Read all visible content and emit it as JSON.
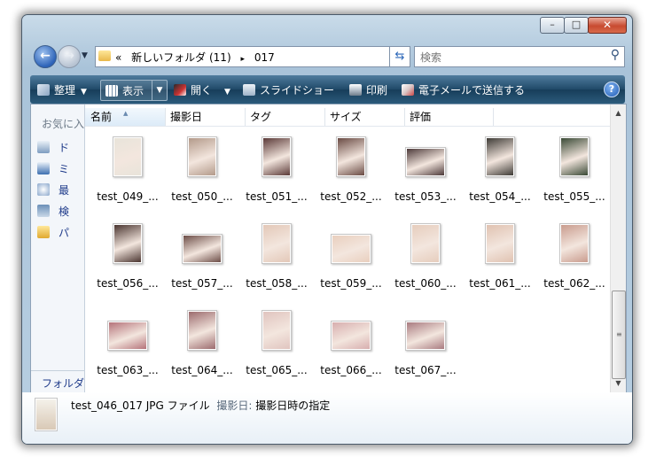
{
  "window": {
    "caption": {
      "minimize": "–",
      "maximize": "□",
      "close": "✕"
    }
  },
  "address": {
    "crumbs": [
      "«",
      "新しいフォルダ (11)",
      "▸",
      "017"
    ],
    "search_placeholder": "検索"
  },
  "toolbar": {
    "organize": "整理",
    "view": "表示",
    "open": "開く",
    "slideshow": "スライドショー",
    "print": "印刷",
    "email": "電子メールで送信する",
    "help": "?"
  },
  "nav": {
    "favorites_title": "お気に入",
    "items": [
      "ド",
      "ミ",
      "最",
      "検",
      "パ"
    ],
    "folders_label": "フォルダ"
  },
  "columns": [
    "名前",
    "撮影日",
    "タグ",
    "サイズ",
    "評価"
  ],
  "files": [
    {
      "label": "test_049_...",
      "tone": "#e8e4da"
    },
    {
      "label": "test_050_...",
      "tone": "#b39a8a"
    },
    {
      "label": "test_051_...",
      "tone": "#5b3a38"
    },
    {
      "label": "test_052_...",
      "tone": "#6a4b44"
    },
    {
      "label": "test_053_...",
      "tone": "#4d3a3a"
    },
    {
      "label": "test_054_...",
      "tone": "#3e3b36"
    },
    {
      "label": "test_055_...",
      "tone": "#3a4a36"
    },
    {
      "label": "test_056_...",
      "tone": "#4a3530"
    },
    {
      "label": "test_057_...",
      "tone": "#6d4e48"
    },
    {
      "label": "test_058_...",
      "tone": "#e3c8b8"
    },
    {
      "label": "test_059_...",
      "tone": "#e9cfbe"
    },
    {
      "label": "test_060_...",
      "tone": "#e6cdbd"
    },
    {
      "label": "test_061_...",
      "tone": "#e0c2b1"
    },
    {
      "label": "test_062_...",
      "tone": "#c99c8e"
    },
    {
      "label": "test_063_...",
      "tone": "#b5737a"
    },
    {
      "label": "test_064_...",
      "tone": "#9c6b6e"
    },
    {
      "label": "test_065_...",
      "tone": "#e0c4bf"
    },
    {
      "label": "test_066_...",
      "tone": "#d7aeae"
    },
    {
      "label": "test_067_...",
      "tone": "#a97b80"
    }
  ],
  "details": {
    "name": "test_046_017",
    "type": "JPG ファイル",
    "date_label": "撮影日:",
    "date_value": "撮影日時の指定"
  },
  "colors": {
    "toolbar_dark": "#1f4968",
    "window_frame": "#a9c3d9",
    "link_blue": "#1e3a8a"
  }
}
